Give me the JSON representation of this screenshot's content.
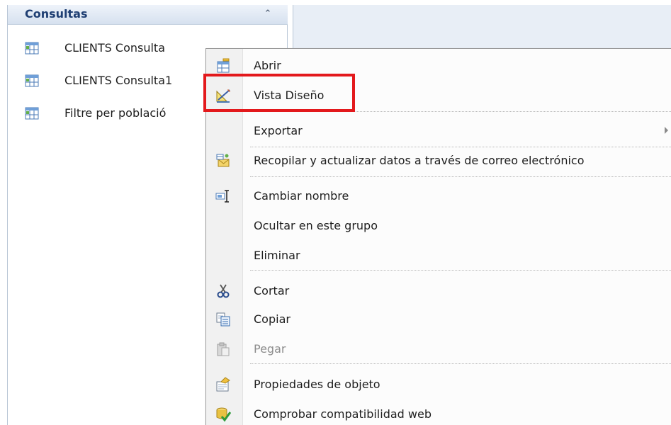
{
  "nav_pane": {
    "group_title": "Consultas",
    "collapse_glyph": "⌃",
    "items": [
      {
        "label": "CLIENTS Consulta",
        "icon": "query-icon"
      },
      {
        "label": "CLIENTS Consulta1",
        "icon": "query-icon"
      },
      {
        "label": "Filtre per població",
        "icon": "query-icon"
      }
    ]
  },
  "context_menu": {
    "items": [
      {
        "id": "open",
        "label": "Abrir",
        "icon": "open-icon"
      },
      {
        "id": "design-view",
        "label": "Vista Diseño",
        "icon": "design-view-icon"
      },
      {
        "id": "export",
        "label": "Exportar",
        "icon": "",
        "submenu": true
      },
      {
        "id": "collect-data",
        "label": "Recopilar y actualizar datos a través de correo electrónico",
        "icon": "collect-data-icon"
      },
      {
        "id": "rename",
        "label": "Cambiar nombre",
        "icon": "rename-icon"
      },
      {
        "id": "hide-in-group",
        "label": "Ocultar en este grupo",
        "icon": ""
      },
      {
        "id": "delete",
        "label": "Eliminar",
        "icon": ""
      },
      {
        "id": "cut",
        "label": "Cortar",
        "icon": "cut-icon"
      },
      {
        "id": "copy",
        "label": "Copiar",
        "icon": "copy-icon"
      },
      {
        "id": "paste",
        "label": "Pegar",
        "icon": "paste-icon",
        "disabled": true
      },
      {
        "id": "object-properties",
        "label": "Propiedades de objeto",
        "icon": "properties-icon"
      },
      {
        "id": "web-compat",
        "label": "Comprobar compatibilidad web",
        "icon": "web-compat-icon"
      }
    ]
  },
  "colors": {
    "highlight": "#e3191c",
    "nav_title": "#1f3f73",
    "disabled_text": "#8d8d8d"
  }
}
